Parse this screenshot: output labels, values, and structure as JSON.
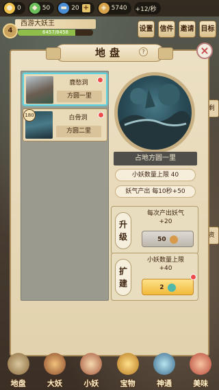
{
  "resources": [
    {
      "icon": "coin-icon",
      "value": "0",
      "color": "#f0c14b"
    },
    {
      "icon": "jade-icon",
      "value": "50",
      "color": "#6bbf5b"
    },
    {
      "icon": "ticket-icon",
      "value": "20",
      "color": "#4a8fd6"
    },
    {
      "icon": "gem-icon",
      "value": "5740",
      "color": "#d6a24a"
    },
    {
      "icon": "energy-icon",
      "value": "+12/秒",
      "color": "#e07a3a"
    }
  ],
  "player": {
    "level": "4",
    "name": "西游大妖王",
    "exp_text": "6457/8458",
    "exp_progress": 0.76
  },
  "top_buttons": [
    "设置",
    "信件",
    "邀请",
    "目标"
  ],
  "panel": {
    "title": "地盘",
    "help": "?",
    "close": "×"
  },
  "territories": [
    {
      "name": "鹿愁洞",
      "place": "方圆一里",
      "selected": true
    },
    {
      "name": "白骨洞",
      "place": "方圆二里",
      "badge": "180",
      "selected": false
    }
  ],
  "detail": {
    "occupied": "占地方圆一里",
    "imp_limit": "小妖数量上限 40",
    "output": "妖气产出 每10秒+50"
  },
  "upgrade": {
    "label": "升级",
    "desc_line1": "每次产出妖气",
    "desc_line2": "+20",
    "cost": "50"
  },
  "expand": {
    "label": "扩建",
    "desc_line1": "小妖数量上限",
    "desc_line2": "+40",
    "cost": "2"
  },
  "bottom_nav": [
    "地盘",
    "大妖",
    "小妖",
    "宝物",
    "神通",
    "美味"
  ],
  "side_labels": {
    "right_a": "剩",
    "right_b": "资"
  }
}
